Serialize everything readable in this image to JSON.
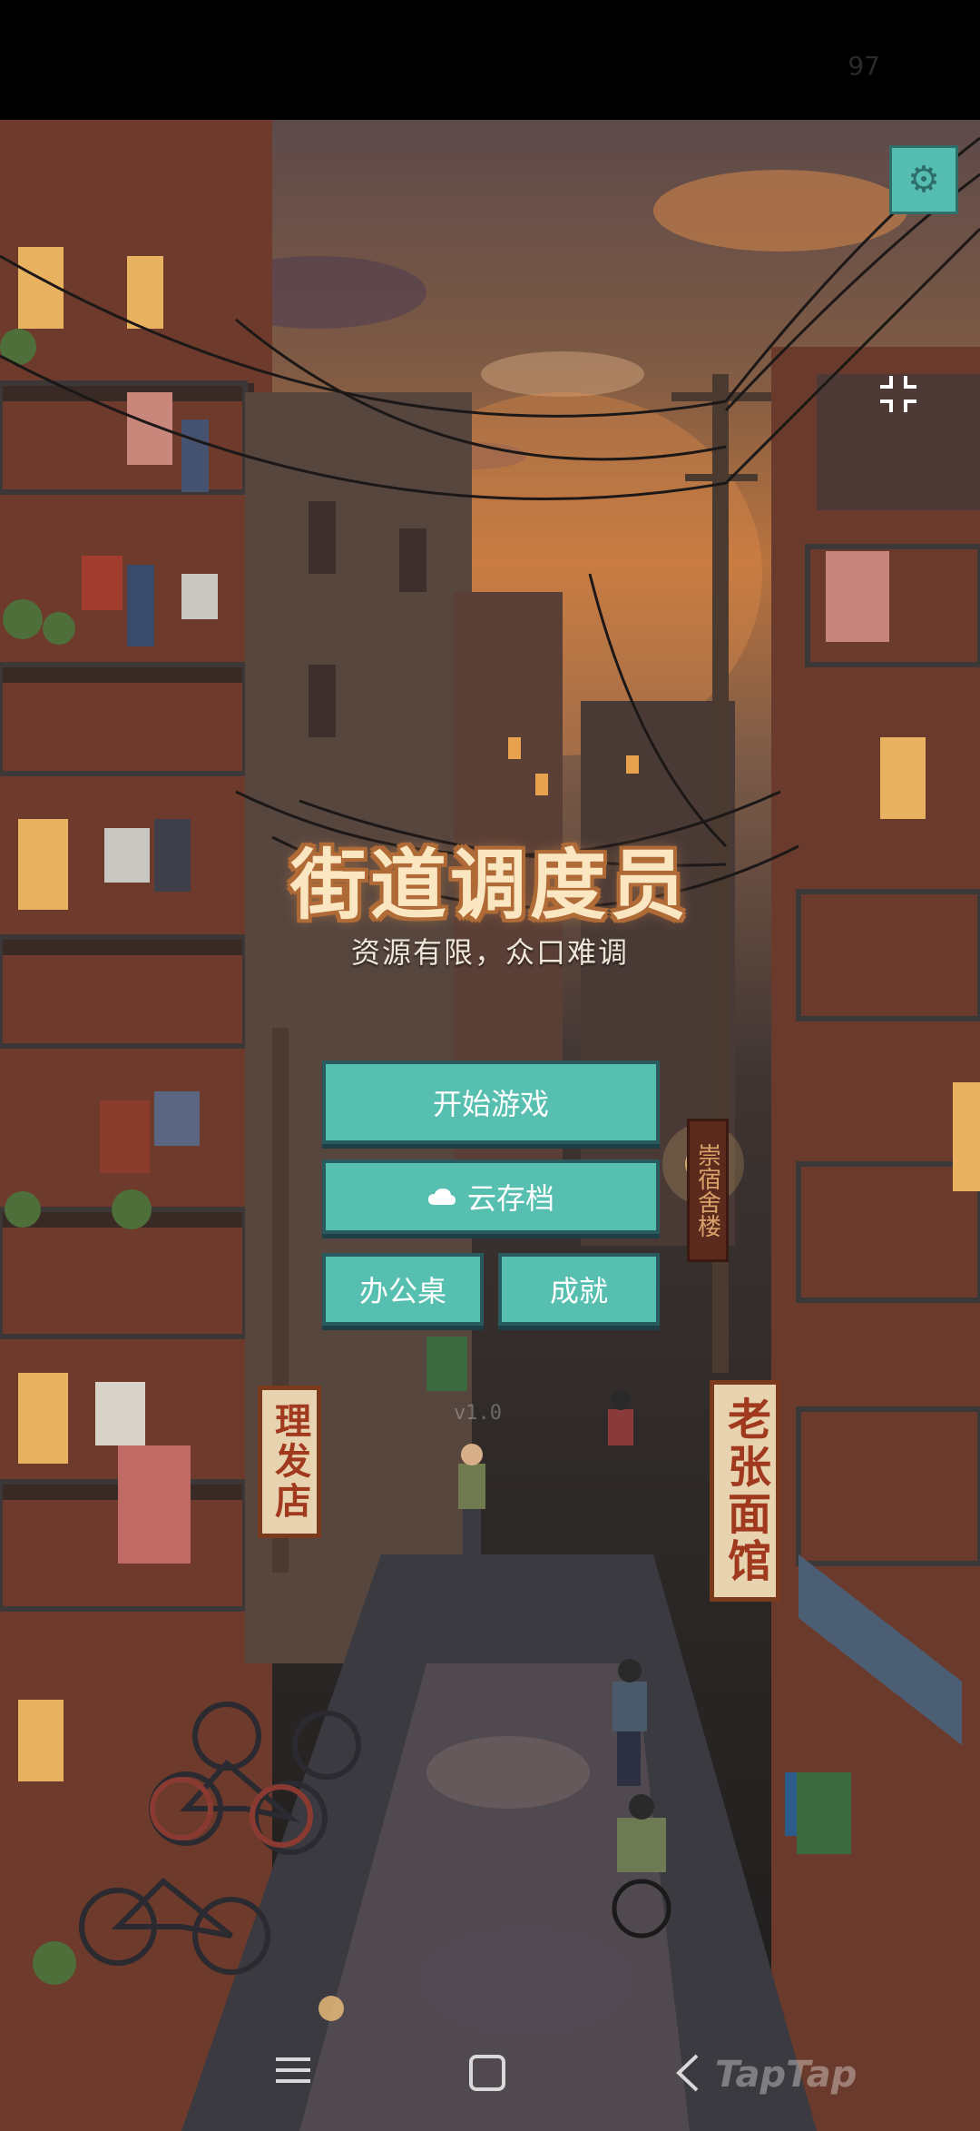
{
  "status_bar": {
    "battery": "97"
  },
  "game": {
    "title": "街道调度员",
    "subtitle": "资源有限，众口难调",
    "version": "v1.0"
  },
  "menu": {
    "start_label": "开始游戏",
    "cloud_label": "云存档",
    "desk_label": "办公桌",
    "achievements_label": "成就"
  },
  "signs": {
    "barber": "理发店",
    "noodle": "老张面馆",
    "dorm": "崇宿舍楼"
  },
  "icons": {
    "settings": "gear-icon",
    "fullscreen": "collapse-icon",
    "cloud": "cloud-icon",
    "nav_menu": "menu-icon",
    "nav_home": "home-icon",
    "nav_back": "back-icon"
  },
  "watermark": "TapTap",
  "colors": {
    "button": "#57bfb0",
    "button_border": "#285a60",
    "title": "#fbe6c2",
    "title_outline": "#b06a36"
  }
}
